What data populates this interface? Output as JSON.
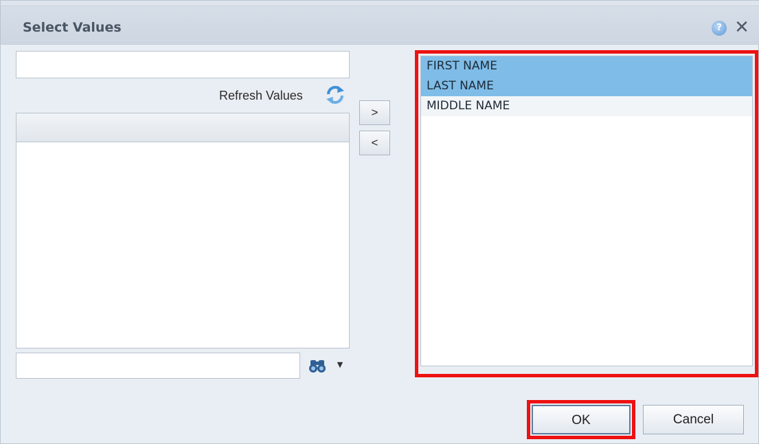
{
  "dialog": {
    "title": "Select Values",
    "help_icon": "help-icon",
    "close_icon": "close-icon"
  },
  "search": {
    "value": "",
    "placeholder": ""
  },
  "refresh": {
    "label": "Refresh Values",
    "icon": "refresh-icon"
  },
  "left_list": {
    "items": []
  },
  "move_buttons": {
    "add_label": ">",
    "remove_label": "<"
  },
  "selected_list": {
    "items": [
      {
        "label": "FIRST NAME",
        "selected": true
      },
      {
        "label": "LAST NAME",
        "selected": true
      },
      {
        "label": "MIDDLE NAME",
        "selected": false
      }
    ]
  },
  "find": {
    "value": "",
    "icon": "binoculars-icon",
    "dropdown_icon": "chevron-down-icon"
  },
  "footer": {
    "ok_label": "OK",
    "cancel_label": "Cancel"
  },
  "colors": {
    "highlight": "#ee1111",
    "selected_item": "#7fbde8",
    "title_text": "#4a5563"
  }
}
